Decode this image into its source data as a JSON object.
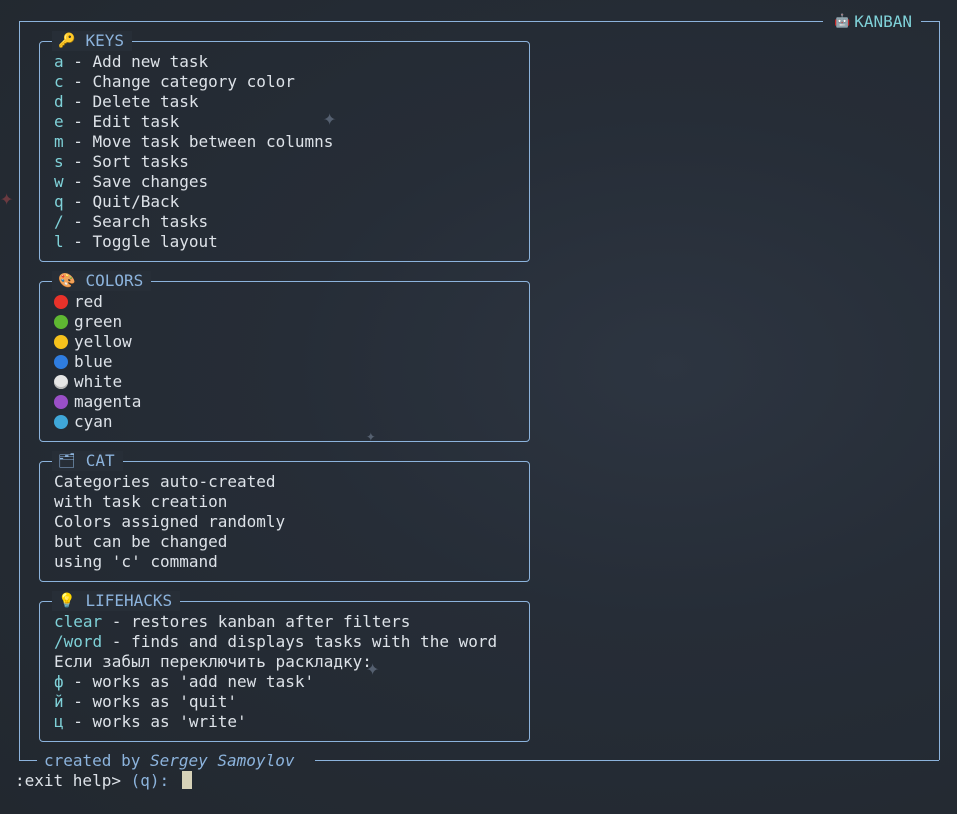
{
  "app": {
    "title": "KANBAN",
    "title_icon": "robot-icon"
  },
  "keys": {
    "title": "KEYS",
    "icon": "key-icon",
    "items": [
      {
        "key": "a",
        "desc": "Add new task"
      },
      {
        "key": "c",
        "desc": "Change category color"
      },
      {
        "key": "d",
        "desc": "Delete task"
      },
      {
        "key": "e",
        "desc": "Edit task"
      },
      {
        "key": "m",
        "desc": "Move task between columns"
      },
      {
        "key": "s",
        "desc": "Sort tasks"
      },
      {
        "key": "w",
        "desc": "Save changes"
      },
      {
        "key": "q",
        "desc": "Quit/Back"
      },
      {
        "key": "/",
        "desc": "Search tasks"
      },
      {
        "key": "l",
        "desc": "Toggle layout"
      }
    ]
  },
  "colors": {
    "title": "COLORS",
    "icon": "palette-icon",
    "items": [
      {
        "name": "red",
        "color": "#e8322a"
      },
      {
        "name": "green",
        "color": "#5fb832"
      },
      {
        "name": "yellow",
        "color": "#f6c21c"
      },
      {
        "name": "blue",
        "color": "#2f7de0"
      },
      {
        "name": "white",
        "color": "#e6e6e6"
      },
      {
        "name": "magenta",
        "color": "#9a4fc7"
      },
      {
        "name": "cyan",
        "color": "#3fa7d9"
      }
    ]
  },
  "cat": {
    "title": "CAT",
    "icon": "card-index-dividers-icon",
    "lines": [
      "Categories auto-created",
      "with task creation",
      "Colors assigned randomly",
      "but can be changed",
      "using 'c' command"
    ]
  },
  "lifehacks": {
    "title": "LIFEHACKS",
    "icon": "lightbulb-icon",
    "items": [
      {
        "key": "clear",
        "desc": " - restores kanban after filters"
      },
      {
        "key": "/word",
        "desc": " - finds and displays tasks with the word"
      },
      {
        "key": "",
        "desc": "Если забыл переключить раскладку:"
      },
      {
        "key": "ф",
        "desc": " - works as 'add new task'"
      },
      {
        "key": "й",
        "desc": " - works as 'quit'"
      },
      {
        "key": "ц",
        "desc": " - works as 'write'"
      }
    ]
  },
  "footer": {
    "prefix": "created by ",
    "author": "Sergey Samoylov"
  },
  "prompt": {
    "text": ":exit help> ",
    "option": "(q): "
  }
}
